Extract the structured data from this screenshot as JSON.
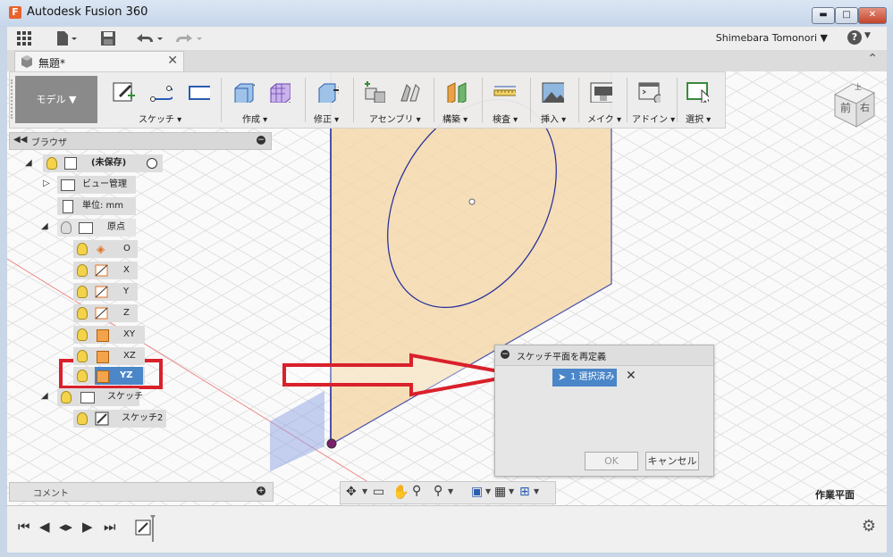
{
  "window": {
    "title": "Autodesk Fusion 360",
    "logo_letter": "F",
    "min_glyph": "▬",
    "max_glyph": "□",
    "close_glyph": "✕"
  },
  "appbar": {
    "user": "Shimebara Tomonori ▼",
    "help": "?",
    "icons": [
      "grid-icon",
      "file-icon",
      "save-icon",
      "undo-icon",
      "redo-icon"
    ]
  },
  "tab": {
    "name": "無題*",
    "close": "✕",
    "collapse": "⌃"
  },
  "toolbar": {
    "mode": "モデル ▼",
    "groups": [
      {
        "label": "スケッチ ▾"
      },
      {
        "label": "作成 ▾"
      },
      {
        "label": "修正 ▾"
      },
      {
        "label": "アセンブリ ▾"
      },
      {
        "label": "構築 ▾"
      },
      {
        "label": "検査 ▾"
      },
      {
        "label": "挿入 ▾"
      },
      {
        "label": "メイク ▾"
      },
      {
        "label": "アドイン ▾"
      },
      {
        "label": "選択 ▾"
      }
    ]
  },
  "viewcube": {
    "front": "前",
    "right": "右",
    "top": "上"
  },
  "browser": {
    "title": "ブラウザ",
    "root": "(未保存)",
    "items": {
      "view_mgmt": "ビュー管理",
      "units": "単位: mm",
      "origin": "原点",
      "o": "O",
      "x": "X",
      "y": "Y",
      "z": "Z",
      "xy": "XY",
      "xz": "XZ",
      "yz": "YZ",
      "sketches": "スケッチ",
      "sketch2": "スケッチ2"
    }
  },
  "comments": {
    "label": "コメント"
  },
  "dialog": {
    "title": "スケッチ平面を再定義",
    "selection": "1 選択済み",
    "ok": "OK",
    "cancel": "キャンセル"
  },
  "status": {
    "workplane": "作業平面"
  },
  "colors": {
    "plane_fill": "#f5d8a8",
    "plane_edge": "#1e2a9b",
    "highlight_red": "#d9202b",
    "selection_blue": "#4a86c8"
  }
}
